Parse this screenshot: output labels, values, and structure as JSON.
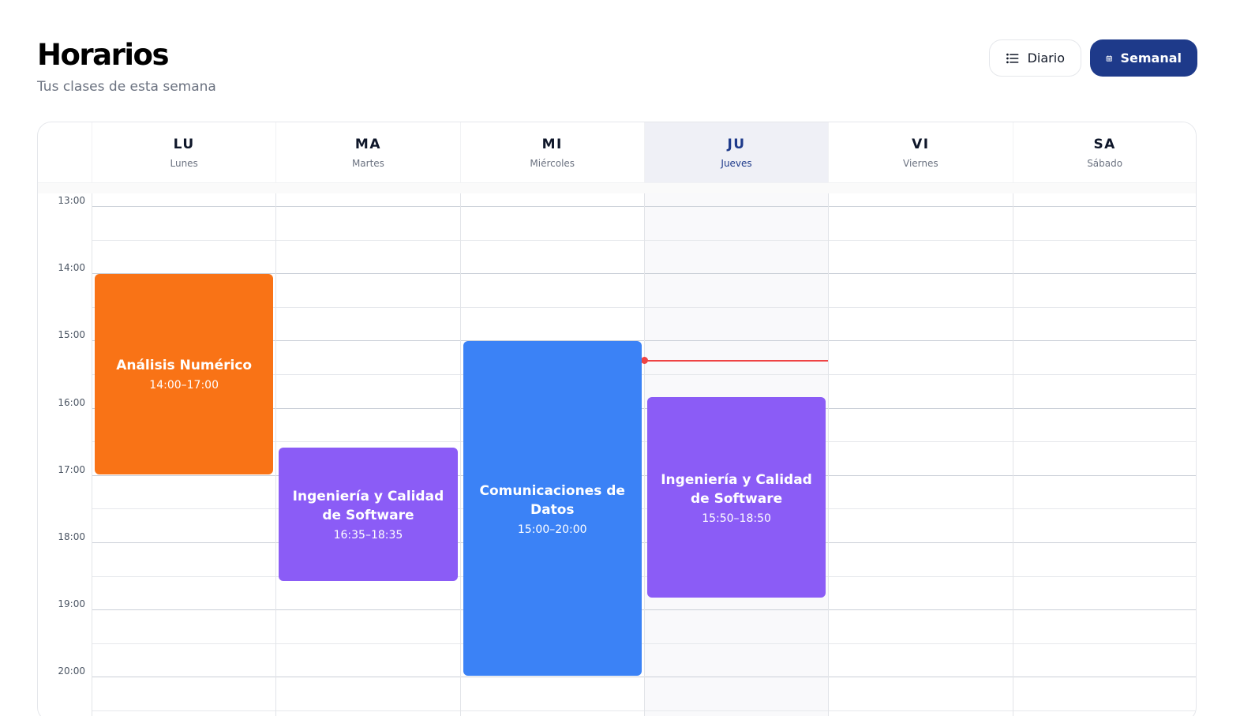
{
  "header": {
    "title": "Horarios",
    "subtitle": "Tus clases de esta semana"
  },
  "view_toggle": {
    "options": [
      {
        "label": "Diario",
        "icon": "list-icon",
        "active": false
      },
      {
        "label": "Semanal",
        "icon": "calendar-icon",
        "active": true
      }
    ]
  },
  "colors": {
    "accent": "#1e3a8a",
    "orange": "#f97316",
    "purple": "#8b5cf6",
    "blue": "#3b82f6",
    "now_indicator": "#ef4444"
  },
  "days": [
    {
      "abbr": "LU",
      "name": "Lunes",
      "today": false
    },
    {
      "abbr": "MA",
      "name": "Martes",
      "today": false
    },
    {
      "abbr": "MI",
      "name": "Miércoles",
      "today": false
    },
    {
      "abbr": "JU",
      "name": "Jueves",
      "today": true
    },
    {
      "abbr": "VI",
      "name": "Viernes",
      "today": false
    },
    {
      "abbr": "SA",
      "name": "Sábado",
      "today": false
    }
  ],
  "time_labels": [
    "13:00",
    "14:00",
    "15:00",
    "16:00",
    "17:00",
    "18:00",
    "19:00",
    "20:00"
  ],
  "events": [
    {
      "title": "Análisis Numérico",
      "time": "14:00–17:00",
      "day": 0,
      "start": "14:00",
      "end": "17:00",
      "color": "#f97316"
    },
    {
      "title": "Ingeniería y Calidad de Software",
      "time": "16:35–18:35",
      "day": 1,
      "start": "16:35",
      "end": "18:35",
      "color": "#8b5cf6"
    },
    {
      "title": "Comunicaciones de Datos",
      "time": "15:00–20:00",
      "day": 2,
      "start": "15:00",
      "end": "20:00",
      "color": "#3b82f6"
    },
    {
      "title": "Ingeniería y Calidad de Software",
      "time": "15:50–18:50",
      "day": 3,
      "start": "15:50",
      "end": "18:50",
      "color": "#8b5cf6"
    }
  ],
  "now_indicator": {
    "day": 3,
    "time": "15:18"
  }
}
